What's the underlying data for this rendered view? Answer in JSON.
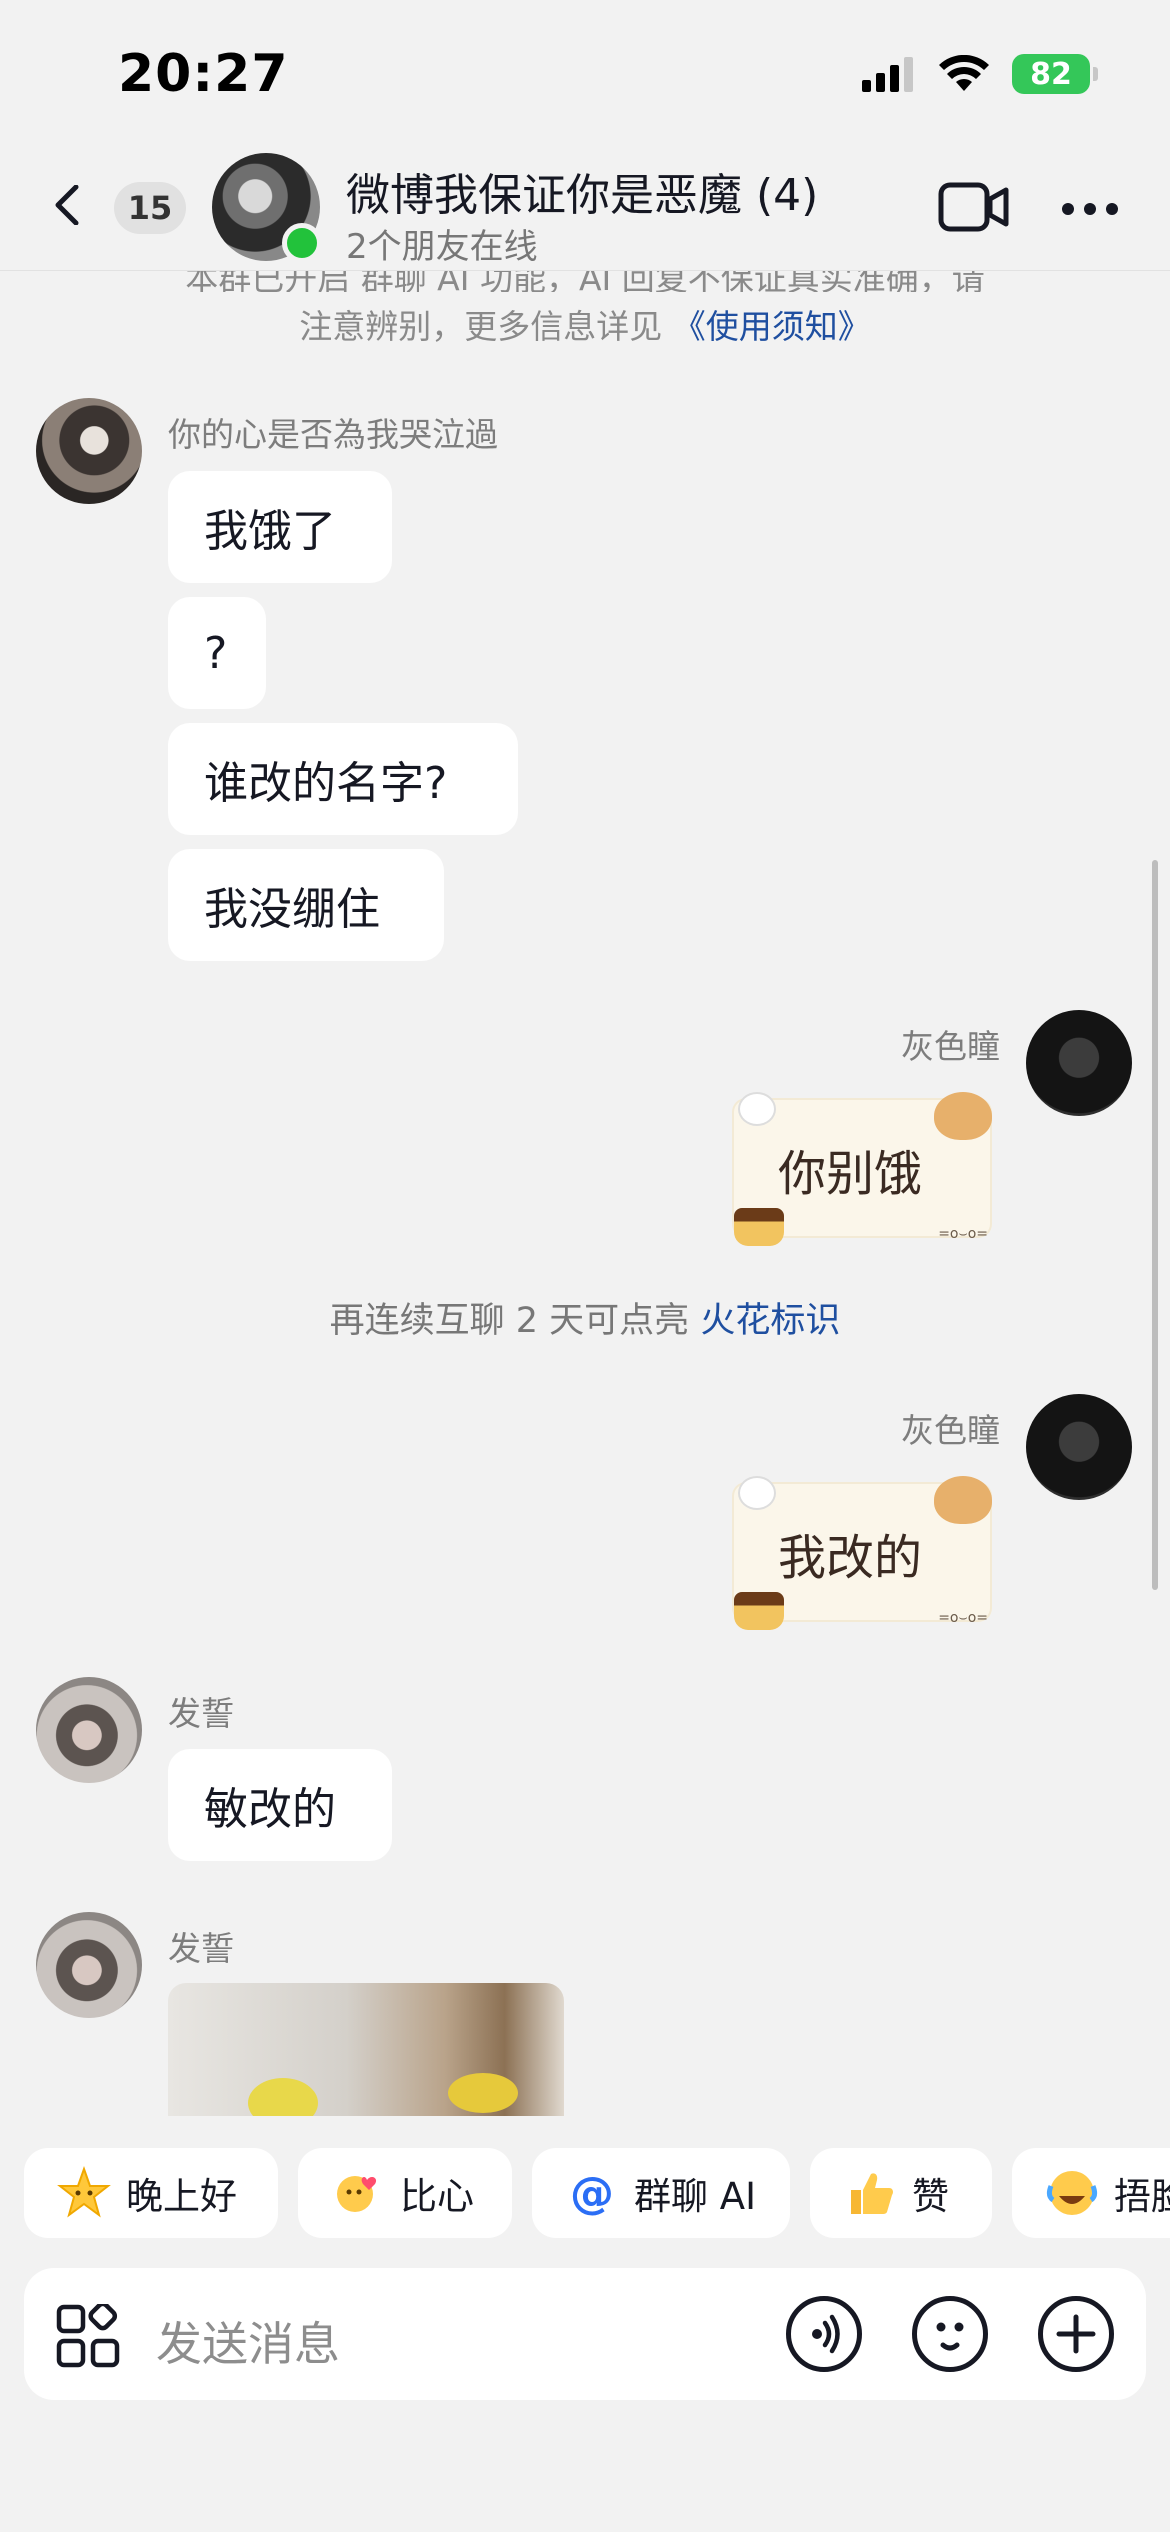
{
  "status_bar": {
    "time": "20:27",
    "battery": "82"
  },
  "header": {
    "unread_count": "15",
    "title": "微博我保证你是恶魔 (4)",
    "subtitle": "2个朋友在线"
  },
  "chat": {
    "notice_line1": "本群已开启 群聊 AI 功能，AI 回复不保证真实准确，请",
    "notice_line2_prefix": "注意辨别，更多信息详见",
    "notice_link": "《使用须知》",
    "messages": [
      {
        "sender": "你的心是否為我哭泣過",
        "bubbles": [
          "我饿了",
          "?",
          "谁改的名字?",
          "我没绷住"
        ]
      },
      {
        "sender": "灰色瞳",
        "sticker": "你别饿"
      },
      {
        "sender": "灰色瞳",
        "sticker": "我改的"
      },
      {
        "sender": "发誓",
        "bubbles": [
          "敏改的"
        ]
      },
      {
        "sender": "发誓"
      }
    ],
    "system_text": "再连续互聊 2 天可点亮",
    "system_link": "火花标识"
  },
  "quick_replies": [
    {
      "label": "晚上好",
      "icon": "star-emoji-icon"
    },
    {
      "label": "比心",
      "icon": "heart-hand-emoji-icon"
    },
    {
      "label": "群聊 AI",
      "icon": "at-icon"
    },
    {
      "label": "赞",
      "icon": "thumbs-up-icon"
    },
    {
      "label": "捂脸",
      "icon": "laugh-cry-emoji-icon"
    }
  ],
  "input": {
    "placeholder": "发送消息"
  },
  "colors": {
    "link": "#1f4fa0",
    "online": "#22c23b",
    "battery": "#34c759",
    "background": "#f2f2f2"
  }
}
